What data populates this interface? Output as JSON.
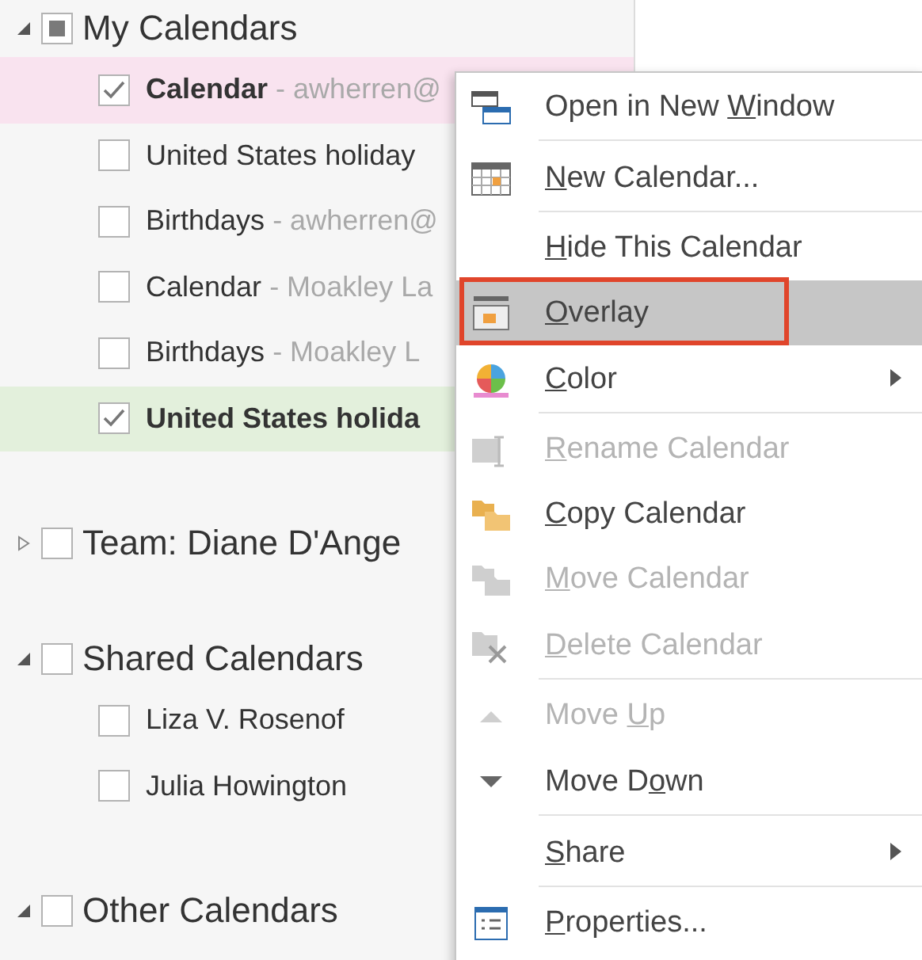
{
  "groups": [
    {
      "label": "My Calendars",
      "expanded": true,
      "partial": true,
      "items": [
        {
          "name": "Calendar",
          "account": "- awherren@",
          "checked": true,
          "color": "#f9e3ef"
        },
        {
          "name": "United States holiday",
          "checked": false
        },
        {
          "name": "Birthdays",
          "account": "- awherren@",
          "checked": false
        },
        {
          "name": "Calendar",
          "account": "- Moakley La",
          "checked": false
        },
        {
          "name": "Birthdays",
          "account": "- Moakley L",
          "checked": false
        },
        {
          "name": "United States holida",
          "checked": true,
          "color": "#e3f0dc"
        }
      ]
    },
    {
      "label": "Team: Diane D'Ange",
      "expanded": false,
      "partial": false
    },
    {
      "label": "Shared Calendars",
      "expanded": true,
      "partial": false,
      "items": [
        {
          "name": "Liza V. Rosenof",
          "checked": false
        },
        {
          "name": "Julia Howington",
          "checked": false
        }
      ]
    },
    {
      "label": "Other Calendars",
      "expanded": true,
      "partial": false
    }
  ],
  "context_menu": {
    "items": [
      {
        "kind": "window",
        "label": {
          "before": "Open in New ",
          "key": "W",
          "after": "indow"
        },
        "disabled": false,
        "selected": false,
        "submenu": false,
        "separator_after": true
      },
      {
        "kind": "calendar",
        "label": {
          "key": "N",
          "after": "ew Calendar..."
        },
        "disabled": false,
        "selected": false,
        "submenu": false,
        "separator_after": true
      },
      {
        "kind": "plain",
        "label": {
          "key": "H",
          "after": "ide This Calendar"
        },
        "disabled": false,
        "selected": false,
        "submenu": false,
        "separator_after": false
      },
      {
        "kind": "overlay",
        "label": {
          "key": "O",
          "after": "verlay"
        },
        "disabled": false,
        "selected": true,
        "submenu": false,
        "separator_after": false
      },
      {
        "kind": "palette",
        "label": {
          "key": "C",
          "after": "olor"
        },
        "disabled": false,
        "selected": false,
        "submenu": true,
        "separator_after": true
      },
      {
        "kind": "rename",
        "label": {
          "key": "R",
          "after": "ename Calendar"
        },
        "disabled": true,
        "selected": false,
        "submenu": false,
        "separator_after": false
      },
      {
        "kind": "folder",
        "label": {
          "key": "C",
          "after": "opy Calendar"
        },
        "disabled": false,
        "selected": false,
        "submenu": false,
        "separator_after": false
      },
      {
        "kind": "folder",
        "label": {
          "key": "M",
          "after": "ove Calendar"
        },
        "disabled": true,
        "selected": false,
        "submenu": false,
        "separator_after": false
      },
      {
        "kind": "delete",
        "label": {
          "key": "D",
          "after": "elete Calendar"
        },
        "disabled": true,
        "selected": false,
        "submenu": false,
        "separator_after": true
      },
      {
        "kind": "up",
        "label": {
          "before": "Move ",
          "key": "U",
          "after": "p"
        },
        "disabled": true,
        "selected": false,
        "submenu": false,
        "separator_after": false
      },
      {
        "kind": "down",
        "label": {
          "before": "Move D",
          "key": "o",
          "after": "wn"
        },
        "disabled": false,
        "selected": false,
        "submenu": false,
        "separator_after": true
      },
      {
        "kind": "plain",
        "label": {
          "key": "S",
          "after": "hare"
        },
        "disabled": false,
        "selected": false,
        "submenu": true,
        "separator_after": true
      },
      {
        "kind": "properties",
        "label": {
          "key": "P",
          "after": "roperties..."
        },
        "disabled": false,
        "selected": false,
        "submenu": false,
        "separator_after": false
      }
    ]
  }
}
